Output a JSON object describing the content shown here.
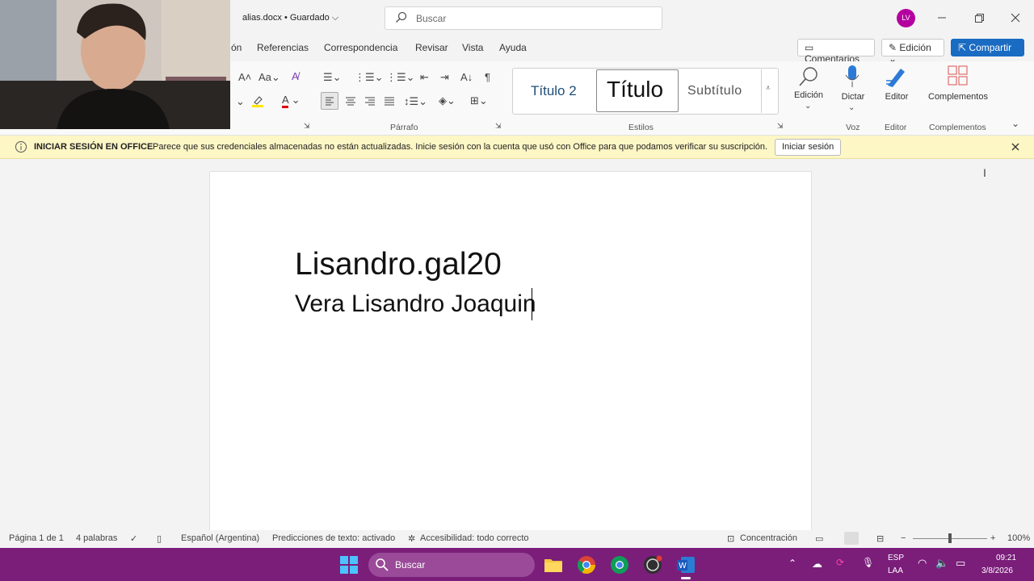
{
  "titlebar": {
    "doc_title": "alias.docx  •  Guardado ⌵",
    "search_placeholder": "Buscar",
    "avatar_initials": "LV"
  },
  "menu": {
    "items": [
      "ón",
      "Referencias",
      "Correspondencia",
      "Revisar",
      "Vista",
      "Ayuda"
    ],
    "comments": "Comentarios",
    "editing": "Edición",
    "share": "Compartir"
  },
  "ribbon": {
    "styles": [
      "Título 2",
      "Título",
      "Subtítulo"
    ],
    "big_buttons": {
      "edicion": "Edición",
      "dictar": "Dictar",
      "editor": "Editor",
      "complementos": "Complementos"
    },
    "sections": {
      "parrafo": "Párrafo",
      "estilos": "Estilos",
      "voz": "Voz",
      "editor": "Editor",
      "complementos": "Complementos"
    }
  },
  "infobar": {
    "title": "INICIAR SESIÓN EN OFFICE",
    "message": "Parece que sus credenciales almacenadas no están actualizadas. Inicie sesión con la cuenta que usó con Office para que podamos verificar su suscripción.",
    "button": "Iniciar sesión"
  },
  "document": {
    "line1": "Lisandro.gal20",
    "line2": "Vera Lisandro Joaquin"
  },
  "status": {
    "page": "Página 1 de 1",
    "words": "4 palabras",
    "language": "Español (Argentina)",
    "predictions": "Predicciones de texto: activado",
    "accessibility": "Accesibilidad: todo correcto",
    "focus": "Concentración",
    "zoom": "100%"
  },
  "taskbar": {
    "search": "Buscar",
    "lang1": "ESP",
    "lang2": "LAA",
    "time": "09:21",
    "date": "3/8/2026"
  },
  "colors": {
    "accent": "#1a6bc2",
    "taskbar": "#7a1e7a",
    "infobar": "#fdf6c5",
    "avatar": "#b4009e"
  }
}
